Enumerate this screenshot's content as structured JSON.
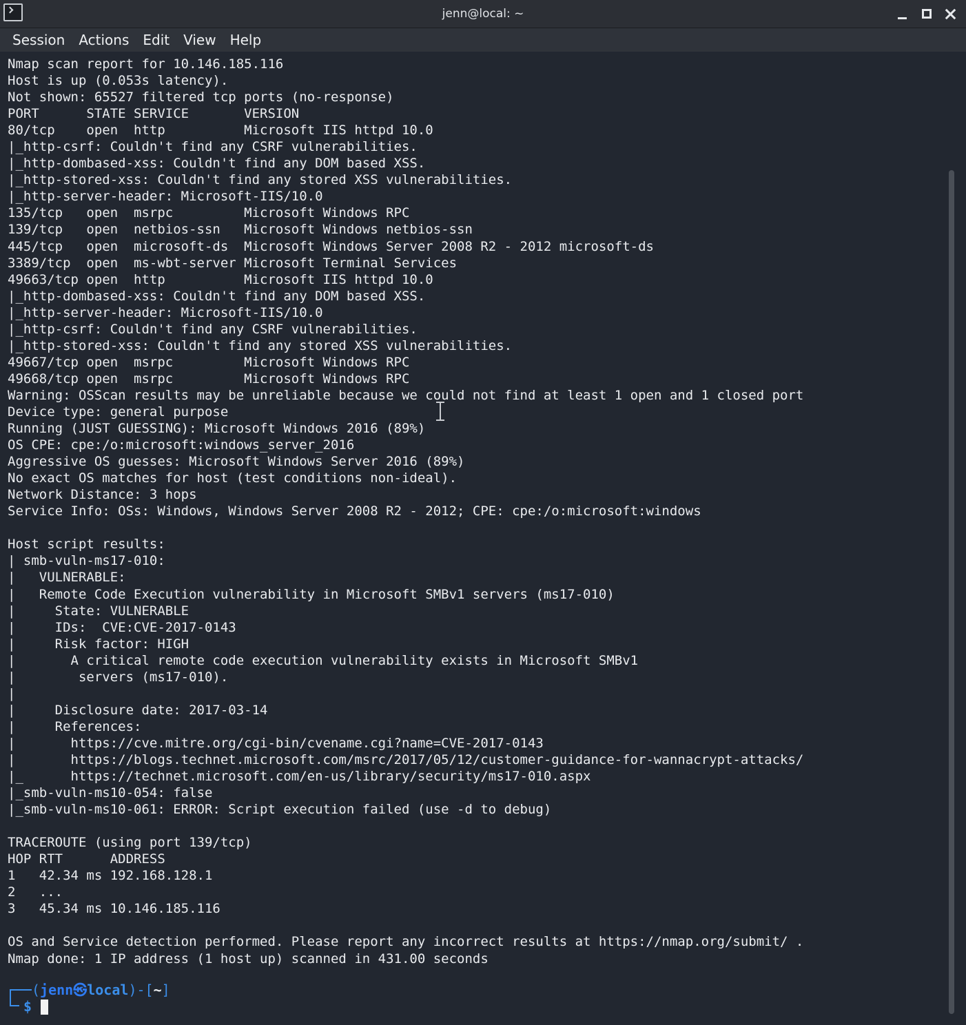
{
  "window": {
    "title": "jenn@local: ~",
    "icon": "terminal-icon"
  },
  "menu": [
    "Session",
    "Actions",
    "Edit",
    "View",
    "Help"
  ],
  "terminal": {
    "lines": [
      "Nmap scan report for 10.146.185.116",
      "Host is up (0.053s latency).",
      "Not shown: 65527 filtered tcp ports (no-response)",
      "PORT      STATE SERVICE       VERSION",
      "80/tcp    open  http          Microsoft IIS httpd 10.0",
      "|_http-csrf: Couldn't find any CSRF vulnerabilities.",
      "|_http-dombased-xss: Couldn't find any DOM based XSS.",
      "|_http-stored-xss: Couldn't find any stored XSS vulnerabilities.",
      "|_http-server-header: Microsoft-IIS/10.0",
      "135/tcp   open  msrpc         Microsoft Windows RPC",
      "139/tcp   open  netbios-ssn   Microsoft Windows netbios-ssn",
      "445/tcp   open  microsoft-ds  Microsoft Windows Server 2008 R2 - 2012 microsoft-ds",
      "3389/tcp  open  ms-wbt-server Microsoft Terminal Services",
      "49663/tcp open  http          Microsoft IIS httpd 10.0",
      "|_http-dombased-xss: Couldn't find any DOM based XSS.",
      "|_http-server-header: Microsoft-IIS/10.0",
      "|_http-csrf: Couldn't find any CSRF vulnerabilities.",
      "|_http-stored-xss: Couldn't find any stored XSS vulnerabilities.",
      "49667/tcp open  msrpc         Microsoft Windows RPC",
      "49668/tcp open  msrpc         Microsoft Windows RPC",
      "Warning: OSScan results may be unreliable because we could not find at least 1 open and 1 closed port",
      "Device type: general purpose",
      "Running (JUST GUESSING): Microsoft Windows 2016 (89%)",
      "OS CPE: cpe:/o:microsoft:windows_server_2016",
      "Aggressive OS guesses: Microsoft Windows Server 2016 (89%)",
      "No exact OS matches for host (test conditions non-ideal).",
      "Network Distance: 3 hops",
      "Service Info: OSs: Windows, Windows Server 2008 R2 - 2012; CPE: cpe:/o:microsoft:windows",
      "",
      "Host script results:",
      "| smb-vuln-ms17-010:",
      "|   VULNERABLE:",
      "|   Remote Code Execution vulnerability in Microsoft SMBv1 servers (ms17-010)",
      "|     State: VULNERABLE",
      "|     IDs:  CVE:CVE-2017-0143",
      "|     Risk factor: HIGH",
      "|       A critical remote code execution vulnerability exists in Microsoft SMBv1",
      "|        servers (ms17-010).",
      "|",
      "|     Disclosure date: 2017-03-14",
      "|     References:",
      "|       https://cve.mitre.org/cgi-bin/cvename.cgi?name=CVE-2017-0143",
      "|       https://blogs.technet.microsoft.com/msrc/2017/05/12/customer-guidance-for-wannacrypt-attacks/",
      "|_      https://technet.microsoft.com/en-us/library/security/ms17-010.aspx",
      "|_smb-vuln-ms10-054: false",
      "|_smb-vuln-ms10-061: ERROR: Script execution failed (use -d to debug)",
      "",
      "TRACEROUTE (using port 139/tcp)",
      "HOP RTT      ADDRESS",
      "1   42.34 ms 192.168.128.1",
      "2   ...",
      "3   45.34 ms 10.146.185.116",
      "",
      "OS and Service detection performed. Please report any incorrect results at https://nmap.org/submit/ .",
      "Nmap done: 1 IP address (1 host up) scanned in 431.00 seconds"
    ],
    "prompt": {
      "open": "(",
      "user": "jenn",
      "at": "㉿",
      "host": "local",
      "mid": ")-[",
      "cwd": "~",
      "close": "]",
      "symbol": "$"
    }
  },
  "colors": {
    "background": "#222730",
    "text": "#e9ebee",
    "prompt": "#3b8eea"
  }
}
